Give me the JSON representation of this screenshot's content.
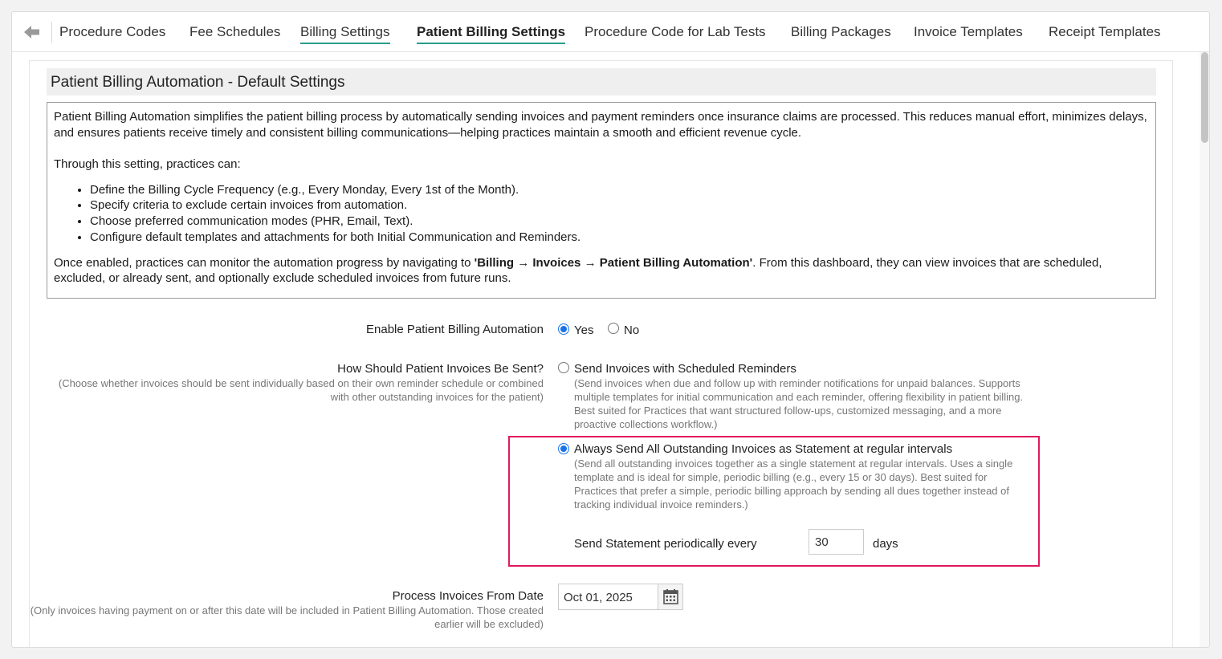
{
  "tabs": [
    "Procedure Codes",
    "Fee Schedules",
    "Billing Settings",
    "Patient Billing Settings",
    "Procedure Code for Lab Tests",
    "Billing Packages",
    "Invoice Templates",
    "Receipt Templates"
  ],
  "section": {
    "title": "Patient Billing Automation - Default Settings",
    "intro": "Patient Billing Automation simplifies the patient billing process by automatically sending invoices and payment reminders once insurance claims are processed. This reduces manual effort, minimizes delays, and ensures patients receive timely and consistent billing communications—helping practices maintain a smooth and efficient revenue cycle.",
    "through": "Through this setting, practices can:",
    "bullets": [
      "Define the Billing Cycle Frequency (e.g., Every Monday, Every 1st of the Month).",
      "Specify criteria to exclude certain invoices from automation.",
      "Choose preferred communication modes (PHR, Email, Text).",
      "Configure default templates and attachments for both Initial Communication and Reminders."
    ],
    "outro_pre": "Once enabled, practices can monitor the automation progress by navigating to ",
    "outro_bold": "'Billing → Invoices → Patient Billing Automation'",
    "outro_post": ". From this dashboard, they can view invoices that are scheduled, excluded, or already sent, and optionally exclude scheduled invoices from future runs."
  },
  "enable": {
    "label": "Enable Patient Billing Automation",
    "yes": "Yes",
    "no": "No",
    "selected": "Yes"
  },
  "send_method": {
    "label": "How Should Patient Invoices Be Sent?",
    "help": "(Choose whether invoices should be sent individually based on their own reminder schedule or combined with other outstanding invoices for the patient)",
    "option1_label": "Send Invoices with Scheduled Reminders",
    "option1_help": "(Send invoices when due and follow up with reminder notifications for unpaid balances. Supports multiple templates for initial communication and each reminder, offering flexibility in patient billing. Best suited for Practices that want structured follow-ups, customized messaging, and a more proactive collections workflow.)",
    "option2_label": "Always Send All Outstanding Invoices as Statement at regular intervals",
    "option2_help": "(Send all outstanding invoices together as a single statement at regular intervals. Uses a single template and is ideal for simple, periodic billing (e.g., every 15 or 30 days). Best suited for Practices that prefer a simple, periodic billing approach by sending all dues together instead of tracking individual invoice reminders.)",
    "selected": 2,
    "period_label": "Send Statement periodically every",
    "period_value": "30",
    "period_unit": "days"
  },
  "process_from": {
    "label": "Process Invoices From Date",
    "help": "(Only invoices having payment on or after this date will be included in Patient Billing Automation. Those created earlier will be excluded)",
    "value": "Oct 01, 2025"
  },
  "colors": {
    "accent": "#2a9d8f",
    "highlight": "#e0195f",
    "radio": "#1a73e8"
  }
}
